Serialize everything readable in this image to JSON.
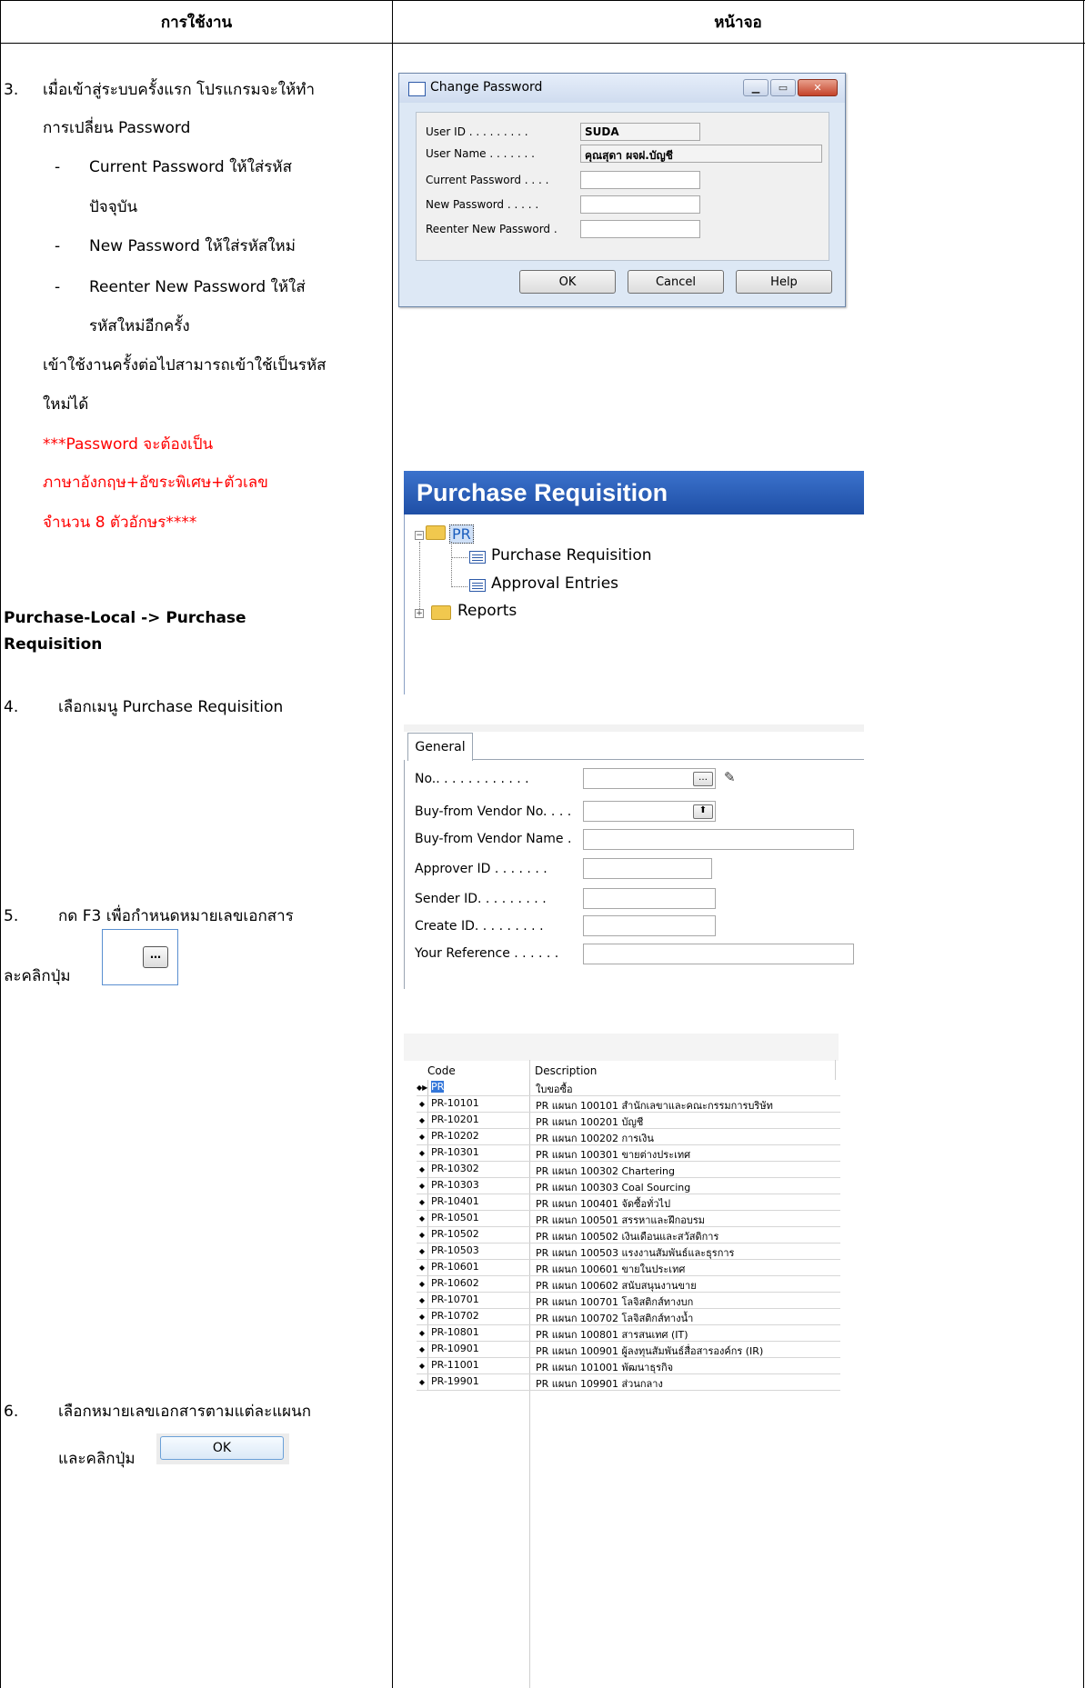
{
  "header": {
    "col_usage": "การใช้งาน",
    "col_screen": "หน้าจอ"
  },
  "step3": {
    "num": "3.",
    "line1": "เมื่อเข้าสู่ระบบครั้งแรก โปรแกรมจะให้ทำ",
    "line2": "การเปลี่ยน Password",
    "b1_a": "Current Password  ให้ใส่รหัส",
    "b1_b": "ปัจจุบัน",
    "b2": "New Password ให้ใส่รหัสใหม่",
    "b3_a": "Reenter New Password ให้ใส่",
    "b3_b": "รหัสใหม่อีกครั้ง",
    "dash": "-",
    "after1": "เข้าใช้งานครั้งต่อไปสามารถเข้าใช้เป็นรหัส",
    "after2": "ใหม่ได้",
    "red1": "***Password จะต้องเป็น",
    "red2": "ภาษาอังกฤษ+อัขระพิเศษ+ตัวเลข",
    "red3": "จำนวน 8 ตัวอักษร****"
  },
  "menu_path": {
    "line1": "Purchase-Local ->  Purchase",
    "line2": "Requisition"
  },
  "step4": {
    "num": "4.",
    "text": "เลือกเมนู Purchase Requisition"
  },
  "step5": {
    "num": "5.",
    "text": "กด F3 เพื่อกำหนดหมายเลขเอกสาร",
    "text2": "ละคลิกปุ่ม"
  },
  "step6": {
    "num": "6.",
    "text": "เลือกหมายเลขเอกสารตามแต่ละแผนก",
    "text2": "และคลิกปุ่ม",
    "ok_label": "OK"
  },
  "dialog": {
    "title": "Change Password",
    "labels": {
      "user_id": "User ID . . . . . . . . .",
      "user_name": "User Name  . . . . . . .",
      "current": "Current Password . . . .",
      "new": "New Password  . . . . .",
      "reenter": "Reenter New Password ."
    },
    "values": {
      "user_id": "SUDA",
      "user_name": "คุณสุดา ผจฝ.บัญชี"
    },
    "buttons": {
      "ok": "OK",
      "cancel": "Cancel",
      "help": "Help"
    }
  },
  "tree": {
    "title": "Purchase Requisition",
    "root": "PR",
    "items": [
      "Purchase Requisition",
      "Approval Entries"
    ],
    "reports": "Reports"
  },
  "general_form": {
    "tab": "General",
    "labels": [
      "No.. . . . . . . . . . . .",
      "Buy-from Vendor No. . . .",
      "Buy-from Vendor Name  .",
      "Approver ID  . . . . . . .",
      "Sender ID. . . . . . . . .",
      "Create ID. . . . . . . . .",
      "Your Reference . . . . . ."
    ]
  },
  "series_list": {
    "col_code": "Code",
    "col_desc": "Description",
    "rows": [
      {
        "code": "PR",
        "desc": "ใบขอซื้อ"
      },
      {
        "code": "PR-10101",
        "desc": "PR แผนก 100101 สำนักเลขาและคณะกรรมการบริษัท"
      },
      {
        "code": "PR-10201",
        "desc": "PR แผนก 100201 บัญชี"
      },
      {
        "code": "PR-10202",
        "desc": "PR แผนก 100202 การเงิน"
      },
      {
        "code": "PR-10301",
        "desc": "PR แผนก 100301 ขายต่างประเทศ"
      },
      {
        "code": "PR-10302",
        "desc": "PR แผนก 100302 Chartering"
      },
      {
        "code": "PR-10303",
        "desc": "PR แผนก 100303 Coal Sourcing"
      },
      {
        "code": "PR-10401",
        "desc": "PR แผนก 100401 จัดซื้อทั่วไป"
      },
      {
        "code": "PR-10501",
        "desc": "PR แผนก 100501 สรรหาและฝึกอบรม"
      },
      {
        "code": "PR-10502",
        "desc": "PR แผนก 100502 เงินเดือนและสวัสดิการ"
      },
      {
        "code": "PR-10503",
        "desc": "PR แผนก 100503 แรงงานสัมพันธ์และธุรการ"
      },
      {
        "code": "PR-10601",
        "desc": "PR แผนก 100601 ขายในประเทศ"
      },
      {
        "code": "PR-10602",
        "desc": "PR แผนก 100602 สนับสนุนงานขาย"
      },
      {
        "code": "PR-10701",
        "desc": "PR แผนก 100701 โลจิสติกส์ทางบก"
      },
      {
        "code": "PR-10702",
        "desc": "PR แผนก 100702 โลจิสติกส์ทางน้ำ"
      },
      {
        "code": "PR-10801",
        "desc": "PR แผนก 100801 สารสนเทศ (IT)"
      },
      {
        "code": "PR-10901",
        "desc": "PR แผนก 100901 ผู้ลงทุนสัมพันธ์สื่อสารองค์กร (IR)"
      },
      {
        "code": "PR-11001",
        "desc": "PR แผนก 101001 พัฒนาธุรกิจ"
      },
      {
        "code": "PR-19901",
        "desc": "PR แผนก 109901 ส่วนกลาง"
      }
    ]
  }
}
